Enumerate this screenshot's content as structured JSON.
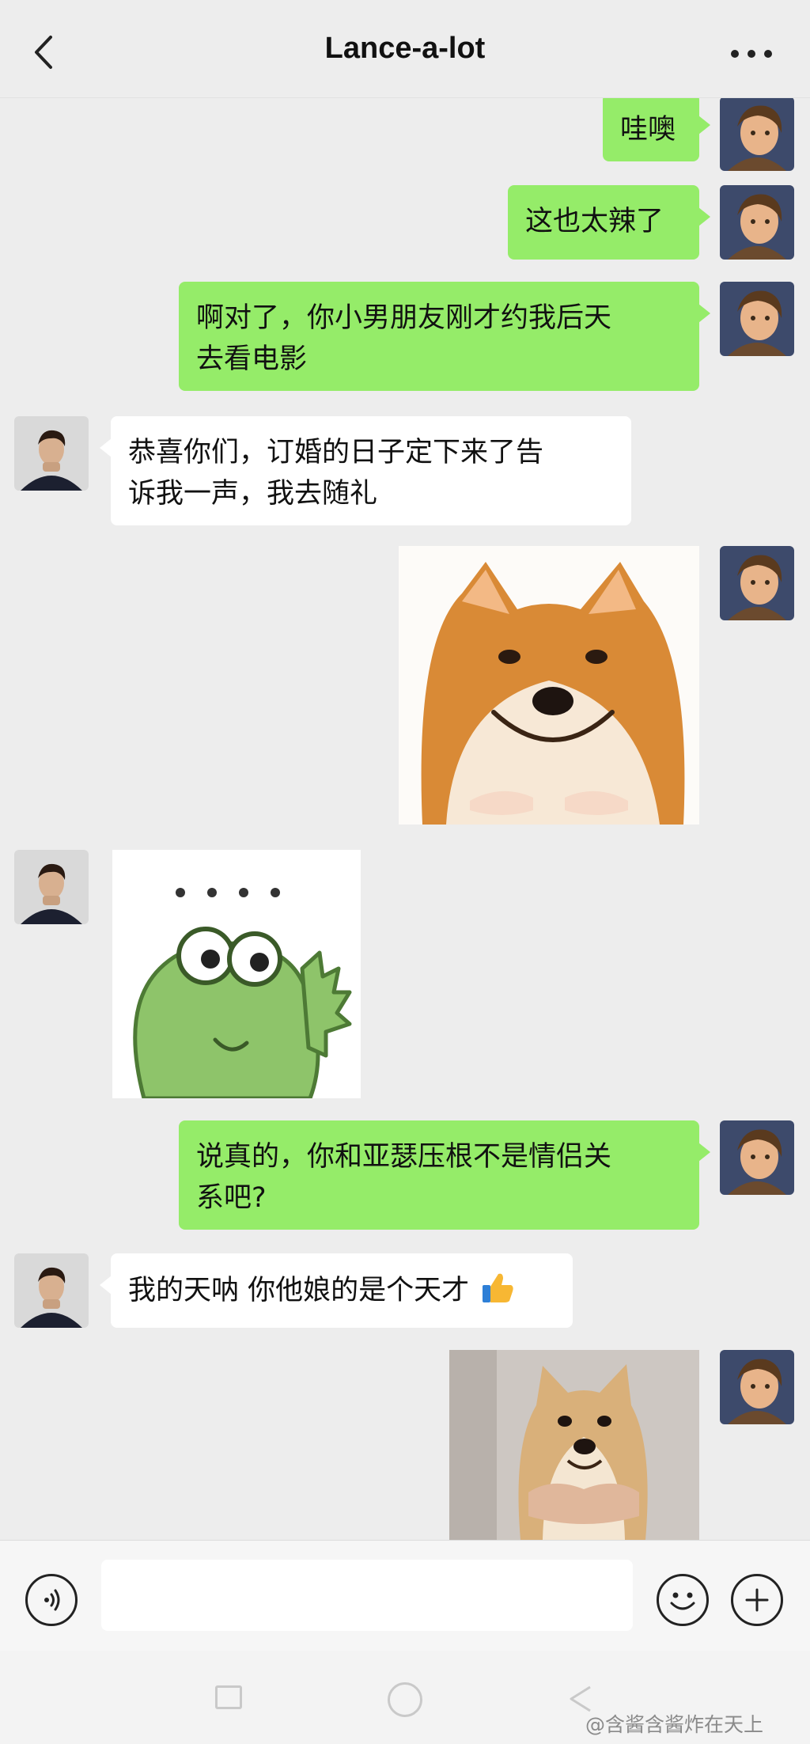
{
  "header": {
    "title": "Lance-a-lot",
    "back_icon": "chevron-left-icon",
    "more_icon": "more-dots-icon"
  },
  "messages": [
    {
      "from": "self",
      "type": "text",
      "lines": [
        "哇噢"
      ]
    },
    {
      "from": "self",
      "type": "text",
      "lines": [
        "这也太辣了"
      ]
    },
    {
      "from": "self",
      "type": "text",
      "lines": [
        "啊对了，你小男朋友刚才约我后天",
        "去看电影"
      ]
    },
    {
      "from": "other",
      "type": "text",
      "lines": [
        "恭喜你们，订婚的日子定下来了告",
        "诉我一声，我去随礼"
      ]
    },
    {
      "from": "self",
      "type": "sticker",
      "sticker": "shiba-smile-sticker"
    },
    {
      "from": "other",
      "type": "sticker",
      "sticker": "frog-dots-sticker"
    },
    {
      "from": "self",
      "type": "text",
      "lines": [
        "说真的，你和亚瑟压根不是情侣关",
        "系吧?"
      ]
    },
    {
      "from": "other",
      "type": "text",
      "lines": [
        "我的天呐 你他娘的是个天才"
      ],
      "emoji": "thumbs-up-emoji"
    },
    {
      "from": "self",
      "type": "sticker",
      "sticker": "shiba-held-sticker"
    }
  ],
  "input_bar": {
    "voice_icon": "voice-icon",
    "input_value": "",
    "emoji_icon": "emoji-icon",
    "plus_icon": "plus-icon"
  },
  "nav_bar": {
    "watermark": "@含酱含酱炸在天上"
  },
  "colors": {
    "background": "#ededed",
    "self_bubble": "#95ec69",
    "other_bubble": "#ffffff"
  }
}
